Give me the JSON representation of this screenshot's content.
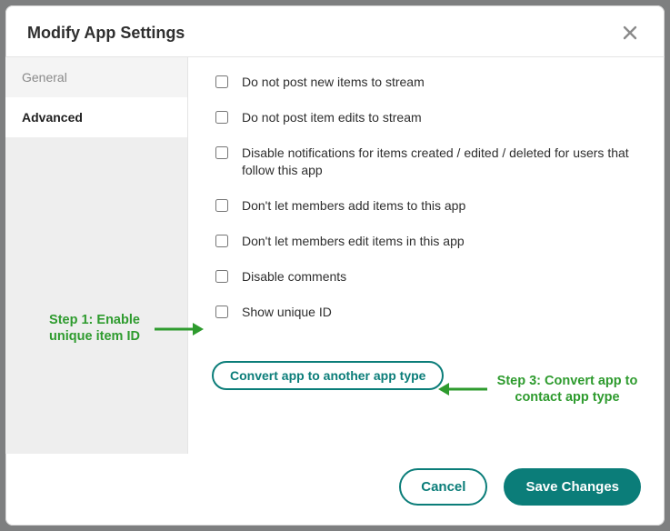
{
  "dialog": {
    "title": "Modify App Settings"
  },
  "sidebar": {
    "tabs": [
      {
        "label": "General"
      },
      {
        "label": "Advanced"
      }
    ]
  },
  "options": [
    {
      "label": "Do not post new items to stream"
    },
    {
      "label": "Do not post item edits to stream"
    },
    {
      "label": "Disable notifications for items created / edited / deleted for users that follow this app"
    },
    {
      "label": "Don't let members add items to this app"
    },
    {
      "label": "Don't let members edit items in this app"
    },
    {
      "label": "Disable comments"
    },
    {
      "label": "Show unique ID"
    }
  ],
  "convert_button_label": "Convert app to another app type",
  "footer": {
    "cancel": "Cancel",
    "save": "Save Changes"
  },
  "annotations": {
    "step1": "Step 1: Enable unique item ID",
    "step3": "Step 3: Convert app to contact app type"
  }
}
